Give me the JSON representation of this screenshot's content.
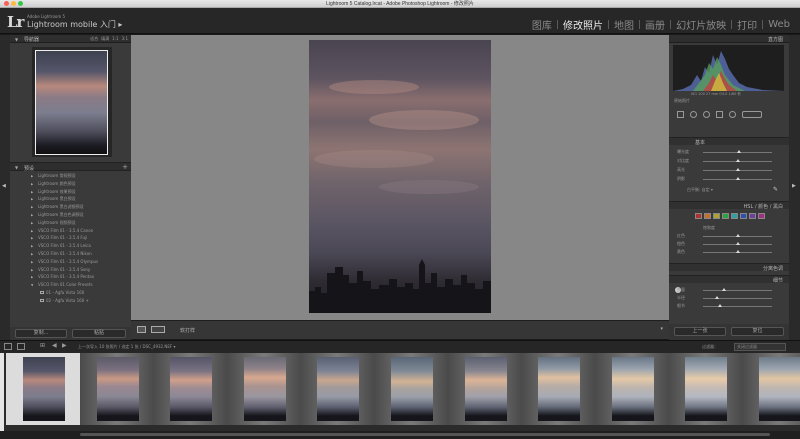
{
  "window": {
    "title": "Lightroom 5 Catalog.lrcat - Adobe Photoshop Lightroom - 修改照片"
  },
  "identity": {
    "small": "Adobe Lightroom 5",
    "main": "Lightroom mobile 入门 ▸"
  },
  "modules": [
    {
      "label": "图库",
      "active": false
    },
    {
      "label": "修改照片",
      "active": true
    },
    {
      "label": "地图",
      "active": false
    },
    {
      "label": "画册",
      "active": false
    },
    {
      "label": "幻灯片放映",
      "active": false
    },
    {
      "label": "打印",
      "active": false
    },
    {
      "label": "Web",
      "active": false
    }
  ],
  "left_panel": {
    "navigator_label": "导航器",
    "navigator_options": [
      "适合",
      "填满",
      "1:1",
      "3:1"
    ],
    "presets_label": "预设",
    "presets": [
      {
        "label": "Lightroom 常规预设",
        "kind": "folder"
      },
      {
        "label": "Lightroom 颜色预设",
        "kind": "folder"
      },
      {
        "label": "Lightroom 效果预设",
        "kind": "folder"
      },
      {
        "label": "Lightroom 黑白预设",
        "kind": "folder"
      },
      {
        "label": "Lightroom 黑白滤镜预设",
        "kind": "folder"
      },
      {
        "label": "Lightroom 黑白色调预设",
        "kind": "folder"
      },
      {
        "label": "Lightroom 视频预设",
        "kind": "folder"
      },
      {
        "label": "VSCO Film 01 - 3.5.4 Canon",
        "kind": "folder"
      },
      {
        "label": "VSCO Film 01 - 3.5.4 Fuji",
        "kind": "folder"
      },
      {
        "label": "VSCO Film 01 - 3.5.4 Leica",
        "kind": "folder"
      },
      {
        "label": "VSCO Film 01 - 3.5.4 Nikon",
        "kind": "folder"
      },
      {
        "label": "VSCO Film 01 - 3.5.4 Olympus",
        "kind": "folder"
      },
      {
        "label": "VSCO Film 01 - 3.5.4 Sony",
        "kind": "folder"
      },
      {
        "label": "VSCO Film 01 - 3.5.4 Pentax",
        "kind": "folder"
      },
      {
        "label": "VSCO Film 01 Color Presets",
        "kind": "folder-open"
      },
      {
        "label": "01 - Agfa Vista 160",
        "kind": "preset"
      },
      {
        "label": "02 - Agfa Vista 160 +",
        "kind": "preset"
      }
    ],
    "copy_button": "复制...",
    "paste_button": "粘贴"
  },
  "toolbar": {
    "before_after_label": "修改前/后",
    "softproof_label": "软打样"
  },
  "right_panel": {
    "histogram_label": "直方图",
    "histogram_info": "ISO 100   27 mm   f/4.0   1/60 秒",
    "original_label": "原始照片",
    "basic_label": "基本",
    "sliders_basic": [
      {
        "label": "曝光度",
        "pos": 0.52
      },
      {
        "label": "对比度",
        "pos": 0.5
      },
      {
        "label": "高光",
        "pos": 0.5
      },
      {
        "label": "阴影",
        "pos": 0.5
      }
    ],
    "auto_label": "白平衡: 自定 ▾",
    "hsl_tabs": "HSL / 颜色 / 黑白",
    "hsl_section": "饱和度",
    "sliders_hsl": [
      {
        "label": "红色",
        "pos": 0.5
      },
      {
        "label": "橙色",
        "pos": 0.5
      },
      {
        "label": "黄色",
        "pos": 0.5
      }
    ],
    "split_toning_label": "分离色调",
    "detail_label": "细节",
    "sliders_detail": [
      {
        "label": "数量",
        "pos": 0.3
      },
      {
        "label": "半径",
        "pos": 0.2
      },
      {
        "label": "细节",
        "pos": 0.25
      }
    ],
    "previous_button": "上一张",
    "reset_button": "复位"
  },
  "filmstrip_header": {
    "view_label": "1",
    "path_label": "上一次导入   10 张照片 / 选定 1 张 / DSC_4932.NEF ▾",
    "filter_label": "过滤器：",
    "filter_value": "关闭过滤器"
  },
  "colors": {
    "panel_bg": "#3a3a3a",
    "center_bg": "#878787",
    "module_active": "#ececec",
    "module_inactive": "#8a8a8a"
  }
}
